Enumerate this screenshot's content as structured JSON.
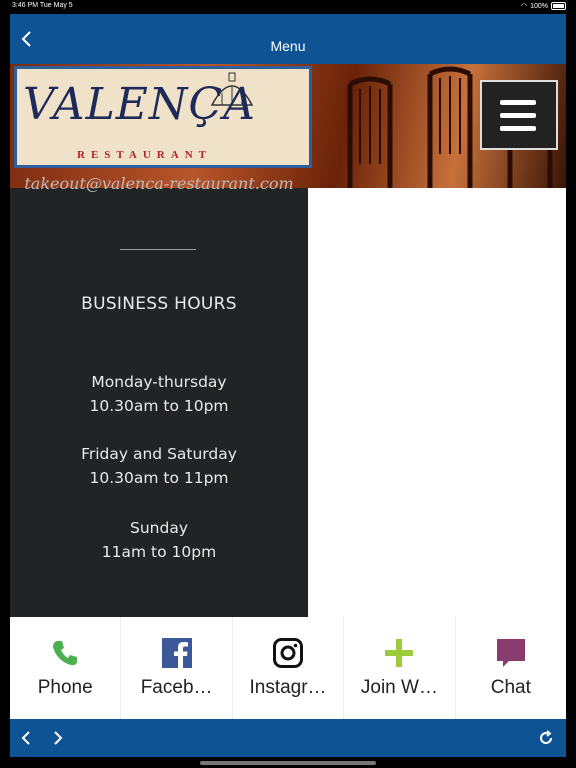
{
  "status_bar": {
    "time": "3:46 PM  Tue May 5",
    "battery": "100%"
  },
  "nav_bar": {
    "title": "Menu"
  },
  "logo": {
    "brand": "VALENÇA",
    "subtitle": "RESTAURANT"
  },
  "content": {
    "email_partial": "takeout@valenca-restaurant.com",
    "heading": "BUSINESS HOURS",
    "hours": [
      {
        "day": "Monday-thursday",
        "time": "10.30am to 10pm"
      },
      {
        "day": "Friday and Saturday",
        "time": "10.30am to 11pm"
      },
      {
        "day": "Sunday",
        "time": "11am to 10pm"
      }
    ]
  },
  "tabs": [
    {
      "label": "Phone",
      "icon": "phone-icon",
      "color": "#4caf50"
    },
    {
      "label": "Faceb…",
      "icon": "facebook-icon",
      "color": "#3b5998"
    },
    {
      "label": "Instagr…",
      "icon": "instagram-icon",
      "color": "#111111"
    },
    {
      "label": "Join W…",
      "icon": "plus-icon",
      "color": "#9ccc3c"
    },
    {
      "label": "Chat",
      "icon": "chat-icon",
      "color": "#8a3b6d"
    }
  ],
  "colors": {
    "nav": "#0e5393",
    "panel": "#222325"
  }
}
